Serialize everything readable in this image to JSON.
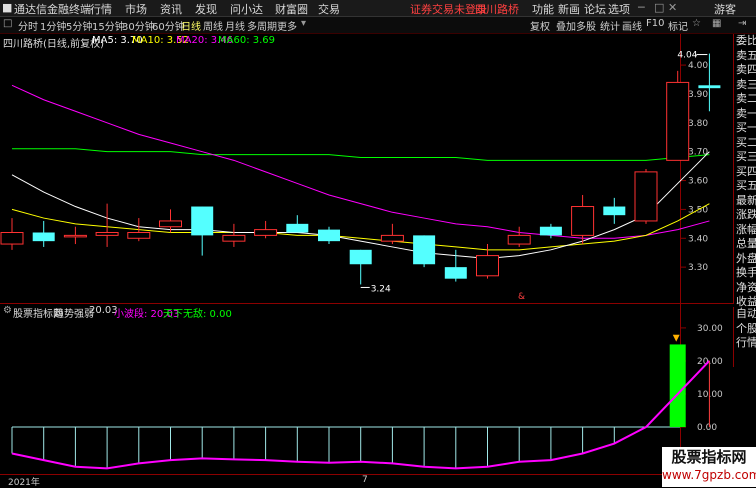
{
  "app": {
    "title": "通达信金融终端",
    "menu": [
      "行情",
      "市场",
      "资讯",
      "发现",
      "问小达",
      "财富圈",
      "交易"
    ],
    "notice": "证券交易未登录",
    "stock_title": "四川路桥",
    "right_menu": [
      "功能",
      "新画",
      "论坛",
      "选项",
      "游客"
    ]
  },
  "toolbar": {
    "periods": [
      "分时",
      "1分钟",
      "5分钟",
      "15分钟",
      "30分钟",
      "60分钟",
      "日线",
      "周线",
      "月线",
      "多周期",
      "更多"
    ],
    "active_period": "日线",
    "tools": [
      "复权",
      "叠加",
      "多股",
      "统计",
      "画线",
      "F10",
      "标记"
    ]
  },
  "price_chart": {
    "stock_label": "四川路桥(日线,前复权)",
    "ma5": "MA5: 3.70",
    "ma10": "MA10: 3.52",
    "ma20": "MA20: 3.46",
    "ma60": "MA60: 3.69",
    "high_label": "4.04",
    "low_label": "3.24",
    "marker": "&",
    "yticks": [
      "4.00",
      "3.90",
      "3.80",
      "3.70",
      "3.60",
      "3.50",
      "3.40",
      "3.30"
    ],
    "ymin": 3.2,
    "ymax": 4.08,
    "candles": [
      {
        "o": 3.38,
        "h": 3.47,
        "l": 3.36,
        "c": 3.42
      },
      {
        "o": 3.42,
        "h": 3.46,
        "l": 3.37,
        "c": 3.39
      },
      {
        "o": 3.41,
        "h": 3.44,
        "l": 3.38,
        "c": 3.41
      },
      {
        "o": 3.41,
        "h": 3.52,
        "l": 3.37,
        "c": 3.42
      },
      {
        "o": 3.4,
        "h": 3.47,
        "l": 3.39,
        "c": 3.42
      },
      {
        "o": 3.44,
        "h": 3.5,
        "l": 3.42,
        "c": 3.46
      },
      {
        "o": 3.51,
        "h": 3.51,
        "l": 3.34,
        "c": 3.41
      },
      {
        "o": 3.39,
        "h": 3.45,
        "l": 3.37,
        "c": 3.41
      },
      {
        "o": 3.41,
        "h": 3.46,
        "l": 3.4,
        "c": 3.43
      },
      {
        "o": 3.45,
        "h": 3.48,
        "l": 3.42,
        "c": 3.42
      },
      {
        "o": 3.43,
        "h": 3.44,
        "l": 3.38,
        "c": 3.39
      },
      {
        "o": 3.36,
        "h": 3.36,
        "l": 3.24,
        "c": 3.31
      },
      {
        "o": 3.39,
        "h": 3.45,
        "l": 3.38,
        "c": 3.41
      },
      {
        "o": 3.41,
        "h": 3.41,
        "l": 3.3,
        "c": 3.31
      },
      {
        "o": 3.3,
        "h": 3.36,
        "l": 3.25,
        "c": 3.26
      },
      {
        "o": 3.27,
        "h": 3.38,
        "l": 3.26,
        "c": 3.34
      },
      {
        "o": 3.38,
        "h": 3.44,
        "l": 3.37,
        "c": 3.41
      },
      {
        "o": 3.44,
        "h": 3.45,
        "l": 3.4,
        "c": 3.41
      },
      {
        "o": 3.41,
        "h": 3.55,
        "l": 3.38,
        "c": 3.51
      },
      {
        "o": 3.51,
        "h": 3.54,
        "l": 3.45,
        "c": 3.48
      },
      {
        "o": 3.46,
        "h": 3.64,
        "l": 3.45,
        "c": 3.63
      },
      {
        "o": 3.67,
        "h": 3.98,
        "l": 3.67,
        "c": 3.94
      },
      {
        "o": 3.93,
        "h": 4.04,
        "l": 3.84,
        "c": 3.92
      }
    ],
    "ma5_values": [
      3.62,
      3.56,
      3.51,
      3.47,
      3.44,
      3.43,
      3.43,
      3.42,
      3.42,
      3.42,
      3.41,
      3.39,
      3.37,
      3.35,
      3.34,
      3.33,
      3.34,
      3.36,
      3.39,
      3.43,
      3.48,
      3.59,
      3.7
    ],
    "ma10_values": [
      3.5,
      3.47,
      3.45,
      3.44,
      3.43,
      3.42,
      3.42,
      3.42,
      3.42,
      3.41,
      3.41,
      3.4,
      3.39,
      3.38,
      3.37,
      3.36,
      3.36,
      3.37,
      3.38,
      3.39,
      3.41,
      3.46,
      3.52
    ],
    "ma20_values": [
      3.93,
      3.88,
      3.84,
      3.8,
      3.76,
      3.73,
      3.7,
      3.67,
      3.63,
      3.59,
      3.55,
      3.52,
      3.49,
      3.47,
      3.45,
      3.44,
      3.42,
      3.41,
      3.4,
      3.4,
      3.41,
      3.43,
      3.46
    ],
    "ma60_values": [
      3.71,
      3.71,
      3.71,
      3.7,
      3.7,
      3.7,
      3.69,
      3.69,
      3.69,
      3.69,
      3.69,
      3.68,
      3.68,
      3.68,
      3.68,
      3.67,
      3.67,
      3.67,
      3.67,
      3.67,
      3.67,
      3.68,
      3.69
    ]
  },
  "right_panel": [
    "委比",
    "卖五",
    "卖四",
    "卖三",
    "卖二",
    "卖一",
    "买一",
    "买二",
    "买三",
    "买四",
    "买五",
    "最新",
    "涨跌",
    "涨幅",
    "总量",
    "外盘",
    "换手",
    "净资",
    "收益"
  ],
  "right_panel2": [
    "自动",
    "个股",
    "行情"
  ],
  "indicator": {
    "source": "股票指标网",
    "title": "趋势强弱",
    "value": "20.03",
    "small_label": "小波段: 20.03",
    "wireless_label": "天下无敌: 0.00",
    "yticks": [
      "30.00",
      "20.00",
      "10.00",
      "0.00"
    ],
    "ymin": -13,
    "ymax": 33,
    "wave": [
      -8,
      -10,
      -12,
      -12.5,
      -11,
      -10,
      -9.5,
      -9.8,
      -10,
      -10.5,
      -10.8,
      -10.5,
      -11,
      -12,
      -12.5,
      -12,
      -10.5,
      -10,
      -8,
      -5,
      0,
      10,
      20.03
    ],
    "green_bar": {
      "index": 21,
      "value": 25
    },
    "bar_top": 0
  },
  "bottom_axis": {
    "year": "2021年",
    "month": "7"
  },
  "watermark": {
    "line1": "股票指标网",
    "line2": "www.7gpzb.com"
  },
  "colors": {
    "up": "#ff3232",
    "down": "#54ffff",
    "ma5": "#ffffff",
    "ma10": "#ffff00",
    "ma20": "#ff00ff",
    "ma60": "#00ff00",
    "wave": "#ff00ff",
    "bar": "#00ff00",
    "frame": "#8b0000"
  }
}
